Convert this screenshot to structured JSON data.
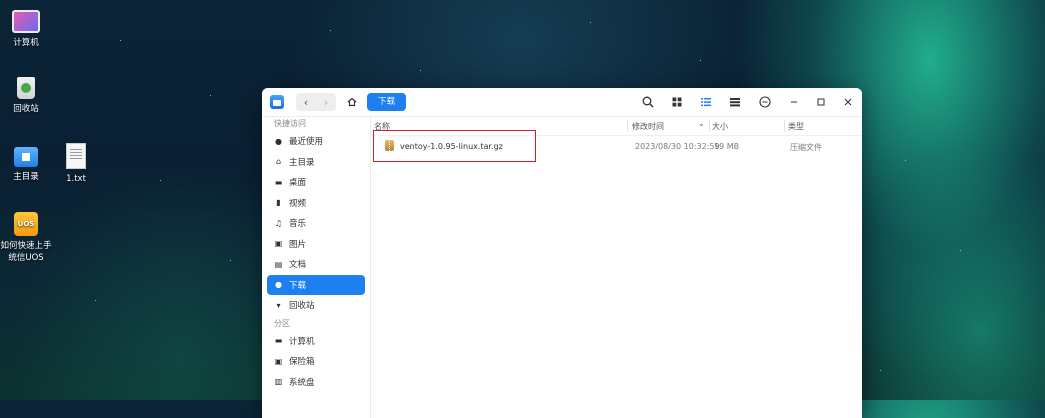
{
  "desktop": {
    "icons": [
      {
        "label": "计算机",
        "icon": "computer-icon"
      },
      {
        "label": "回收站",
        "icon": "trash-icon"
      },
      {
        "label": "主目录",
        "icon": "home-folder-icon"
      },
      {
        "label": "1.txt",
        "icon": "text-file-icon"
      },
      {
        "label": "如何快速上手统信UOS",
        "icon": "uos-guide-icon",
        "icon_text": "UOS"
      }
    ]
  },
  "toolbar": {
    "current_folder": "下载",
    "icons": [
      "search-icon",
      "icon-view-icon",
      "list-view-icon",
      "detail-view-icon",
      "menu-icon",
      "minimize-icon",
      "maximize-icon",
      "close-icon"
    ]
  },
  "sidebar": {
    "quick_access_title": "快捷访问",
    "quick_access": [
      {
        "label": "最近使用",
        "icon": "recent-icon"
      },
      {
        "label": "主目录",
        "icon": "home-icon"
      },
      {
        "label": "桌面",
        "icon": "desktop-icon"
      },
      {
        "label": "视频",
        "icon": "video-icon"
      },
      {
        "label": "音乐",
        "icon": "music-icon"
      },
      {
        "label": "图片",
        "icon": "picture-icon"
      },
      {
        "label": "文档",
        "icon": "document-icon"
      },
      {
        "label": "下载",
        "icon": "download-icon",
        "selected": true
      },
      {
        "label": "回收站",
        "icon": "trash-icon"
      }
    ],
    "partitions_title": "分区",
    "partitions": [
      {
        "label": "计算机",
        "icon": "computer-icon"
      },
      {
        "label": "保险箱",
        "icon": "vault-icon"
      },
      {
        "label": "系统盘",
        "icon": "disk-icon"
      }
    ]
  },
  "file_list": {
    "columns": {
      "name": "名称",
      "modified": "修改时间",
      "size": "大小",
      "type": "类型"
    },
    "rows": [
      {
        "name": "ventoy-1.0.95-linux.tar.gz",
        "modified": "2023/08/30 10:32:59",
        "size": "19 MB",
        "type": "压缩文件",
        "icon": "archive-icon"
      }
    ]
  },
  "colors": {
    "accent": "#1e7ff0",
    "highlight": "#d3202a"
  }
}
